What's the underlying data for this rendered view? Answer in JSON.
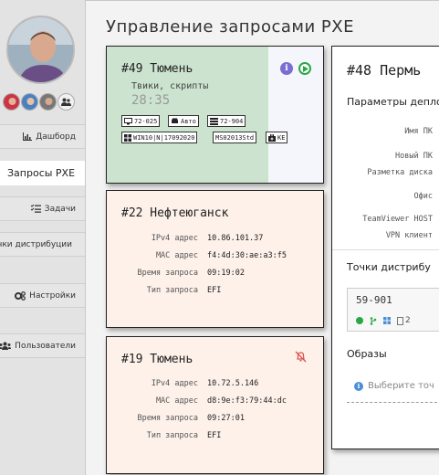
{
  "sidebar": {
    "nav": [
      {
        "label": "Дашборд",
        "icon": "bar-chart-icon"
      },
      {
        "label": "Запросы PXE",
        "active": true
      },
      {
        "label": "Задачи",
        "icon": "task-list-icon"
      },
      {
        "label": "Точки дистрибуции",
        "icon": ""
      },
      {
        "label": "Настройки",
        "icon": "cogs-icon"
      },
      {
        "label": "Пользователи",
        "icon": "users-icon"
      }
    ]
  },
  "main": {
    "title": "Управление запросами PXE"
  },
  "requests": [
    {
      "title": "#49 Тюмень",
      "subtitle": "Твики, скрипты",
      "timer": "28:35",
      "tags": [
        "72-025",
        "Авто",
        "72-904",
        "WIN10|N|17092020",
        "MS02013Std",
        "KE"
      ]
    },
    {
      "title": "#22 Нефтеюганск",
      "fields": [
        {
          "label": "IPv4 адрес",
          "value": "10.86.101.37"
        },
        {
          "label": "MAC адрес",
          "value": "f4:4d:30:ae:a3:f5"
        },
        {
          "label": "Время запроса",
          "value": "09:19:02"
        },
        {
          "label": "Тип запроса",
          "value": "EFI"
        }
      ]
    },
    {
      "title": "#19 Тюмень",
      "fields": [
        {
          "label": "IPv4 адрес",
          "value": "10.72.5.146"
        },
        {
          "label": "MAC адрес",
          "value": "d8:9e:f3:79:44:dc"
        },
        {
          "label": "Время запроса",
          "value": "09:27:01"
        },
        {
          "label": "Тип запроса",
          "value": "EFI"
        }
      ]
    }
  ],
  "detail": {
    "title": "#48 Пермь",
    "params_heading": "Параметры депло",
    "fields": [
      "Имя ПК",
      "Новый ПК",
      "Разметка диска",
      "Офис",
      "TeamViewer HOST",
      "VPN клиент"
    ],
    "points_heading": "Точки дистрибу",
    "point_name": "59-901",
    "point_count": "2",
    "images_heading": "Образы",
    "images_hint": "Выберите точ"
  },
  "colors": {
    "active_card": "#cce4cf",
    "pending_card": "#fdf1ea",
    "accent_green": "#28a745",
    "info_purple": "#7a6fd0",
    "alert_red": "#d9534f"
  }
}
